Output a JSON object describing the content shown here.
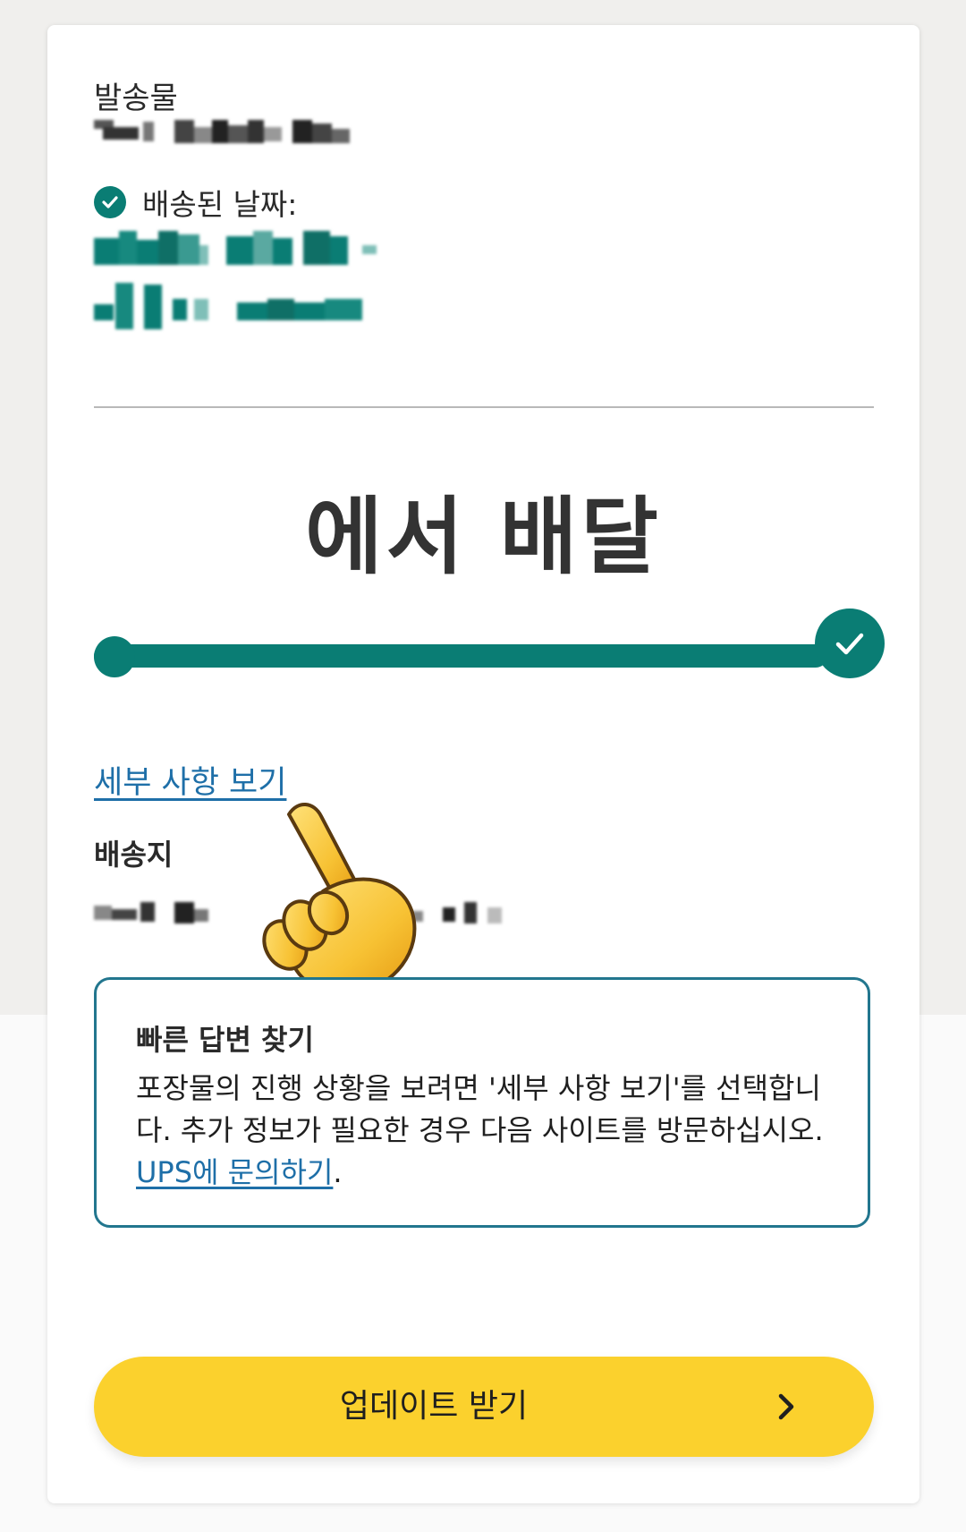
{
  "shipment": {
    "label": "발송물"
  },
  "delivered": {
    "label": "배송된 날짜:"
  },
  "status": {
    "title": "에서 배달",
    "progress": 1.0
  },
  "details_link": "세부 사항 보기",
  "ship_to": {
    "label": "배송지"
  },
  "quick_answers": {
    "title": "빠른 답변 찾기",
    "text": "포장물의 진행 상황을 보려면 '세부 사항 보기'를 선택합니다. 추가 정보가 필요한 경우 다음 사이트를 방문하십시오. ",
    "link": "UPS에 문의하기",
    "suffix": "."
  },
  "update_button": {
    "label": "업데이트 받기"
  },
  "colors": {
    "accent": "#0a7d74",
    "link": "#1e6fa8",
    "button": "#fbd12d",
    "box_border": "#22768e"
  },
  "icons": {
    "delivered_check": "check-circle-icon",
    "progress_complete": "check-icon",
    "button_arrow": "chevron-right-icon",
    "pointer_overlay": "pointing-hand-icon"
  }
}
